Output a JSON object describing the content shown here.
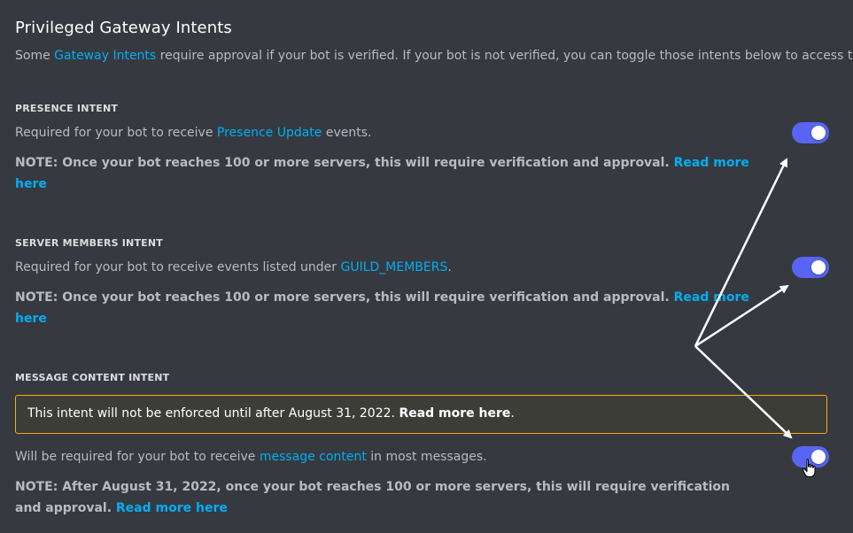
{
  "header": {
    "title": "Privileged Gateway Intents",
    "desc_before": "Some ",
    "desc_link": "Gateway Intents",
    "desc_after": " require approval if your bot is verified. If your bot is not verified, you can toggle those intents below to access them."
  },
  "sections": [
    {
      "title": "PRESENCE INTENT",
      "desc_before": "Required for your bot to receive ",
      "desc_link": "Presence Update",
      "desc_after": " events.",
      "note": "NOTE: Once your bot reaches 100 or more servers, this will require verification and approval. ",
      "note_link": "Read more here",
      "enabled": true
    },
    {
      "title": "SERVER MEMBERS INTENT",
      "desc_before": "Required for your bot to receive events listed under ",
      "desc_link": "GUILD_MEMBERS",
      "desc_after": ".",
      "note": "NOTE: Once your bot reaches 100 or more servers, this will require verification and approval. ",
      "note_link": "Read more here",
      "enabled": true
    },
    {
      "title": "MESSAGE CONTENT INTENT",
      "warning_text": "This intent will not be enforced until after August 31, 2022. ",
      "warning_bold": "Read more here",
      "warning_end": ".",
      "desc_before": "Will be required for your bot to receive ",
      "desc_link": "message content",
      "desc_after": " in most messages.",
      "note": "NOTE: After August 31, 2022, once your bot reaches 100 or more servers, this will require verification and approval. ",
      "note_link": "Read more here",
      "enabled": true
    }
  ],
  "colors": {
    "background": "#36393f",
    "accent": "#5865f2",
    "link": "#00aff4",
    "warning_border": "#faa81a"
  },
  "icons": {
    "cursor": "hand-pointer-icon",
    "annotation": "arrow-icon"
  }
}
